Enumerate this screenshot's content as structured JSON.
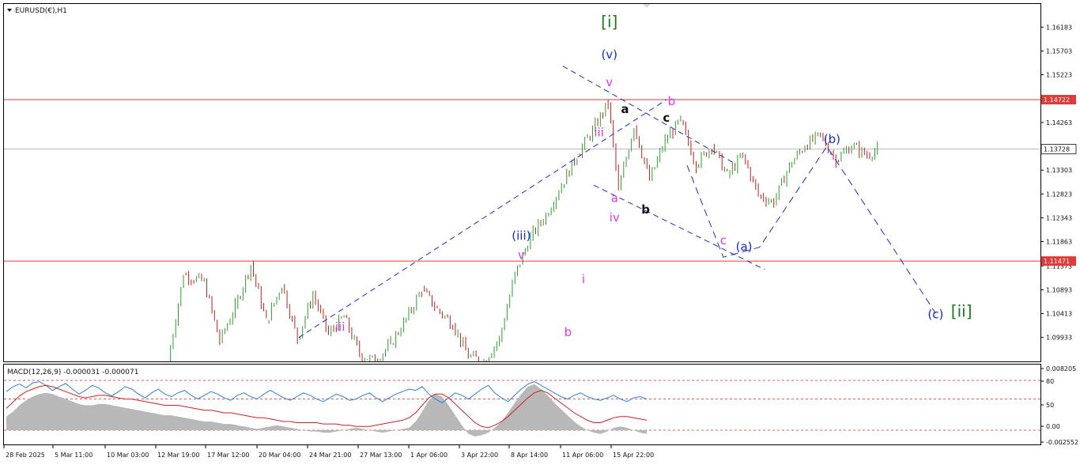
{
  "symbol_label": "EURUSD(€),H1",
  "indicator_label": "MACD(12,26,9) -0.000031 -0.000071",
  "colors": {
    "bull": "#2e9e2e",
    "bear": "#c02020",
    "level_line": "#e03a3a",
    "price_line": "#b8b8b8",
    "projection": "#1a2bc8",
    "wave_blue": "#1a2bc8",
    "wave_magenta": "#e23ae0",
    "wave_black": "#111111",
    "wave_green": "#1f7a1f",
    "macd_hist": "#b8b8b8",
    "macd_line": "#2f7fd6",
    "signal_line": "#d02020",
    "grid_dash": "#e02020"
  },
  "chart_data": [
    {
      "type": "candlestick",
      "symbol": "EURUSD(€)",
      "timeframe": "H1",
      "price_axis": {
        "range": [
          1.0945,
          1.1665
        ],
        "ticks": [
          "1.16183",
          "1.15703",
          "1.15223",
          "1.14263",
          "1.13303",
          "1.12823",
          "1.12343",
          "1.11863",
          "1.11373",
          "1.10893",
          "1.10413",
          "1.09933"
        ]
      },
      "time_axis": {
        "labels": [
          "28 Feb 2025",
          "5 Mar 11:00",
          "10 Mar 03:00",
          "12 Mar 19:00",
          "17 Mar 12:00",
          "20 Mar 04:00",
          "24 Mar 21:00",
          "27 Mar 13:00",
          "1 Apr 06:00",
          "3 Apr 22:00",
          "8 Apr 14:00",
          "11 Apr 06:00",
          "15 Apr 22:00"
        ]
      },
      "horizontal_levels": [
        {
          "price": 1.14722,
          "label": "1.14722"
        },
        {
          "price": 1.11471,
          "label": "1.11471"
        }
      ],
      "current_price": {
        "price": 1.13728,
        "label": "1.13728"
      },
      "price_path": [
        [
          0,
          1.0945
        ],
        [
          3,
          1.112
        ],
        [
          7,
          1.1105
        ],
        [
          10,
          1.0985
        ],
        [
          13,
          1.1055
        ],
        [
          16,
          1.114
        ],
        [
          19,
          1.1025
        ],
        [
          22,
          1.11
        ],
        [
          25,
          1.099
        ],
        [
          28,
          1.108
        ],
        [
          31,
          1.1
        ],
        [
          34,
          1.1035
        ],
        [
          37,
          1.096
        ],
        [
          40,
          1.0945
        ],
        [
          43,
          1.098
        ],
        [
          46,
          1.103
        ],
        [
          49,
          1.109
        ],
        [
          52,
          1.105
        ],
        [
          55,
          1.102
        ],
        [
          58,
          1.0955
        ],
        [
          61,
          1.0945
        ],
        [
          64,
          1.099
        ],
        [
          67,
          1.112
        ],
        [
          70,
          1.1195
        ],
        [
          73,
          1.124
        ],
        [
          76,
          1.13
        ],
        [
          79,
          1.136
        ],
        [
          82,
          1.141
        ],
        [
          85,
          1.1465
        ],
        [
          87,
          1.129
        ],
        [
          90,
          1.142
        ],
        [
          93,
          1.131
        ],
        [
          96,
          1.139
        ],
        [
          99,
          1.143
        ],
        [
          102,
          1.134
        ],
        [
          105,
          1.138
        ],
        [
          108,
          1.132
        ],
        [
          111,
          1.136
        ],
        [
          114,
          1.128
        ],
        [
          117,
          1.1265
        ],
        [
          120,
          1.134
        ],
        [
          123,
          1.138
        ],
        [
          126,
          1.14
        ],
        [
          129,
          1.135
        ],
        [
          132,
          1.138
        ],
        [
          135,
          1.136
        ],
        [
          137,
          1.1372
        ]
      ],
      "wave_labels": [
        {
          "text": "[i]",
          "color_key": "wave_green",
          "bar": 85,
          "price": 1.16183
        },
        {
          "text": "(v)",
          "color_key": "wave_blue",
          "bar": 85,
          "price": 1.1555
        },
        {
          "text": "v",
          "color_key": "wave_magenta",
          "bar": 85,
          "price": 1.1499
        },
        {
          "text": "iii",
          "color_key": "wave_magenta",
          "bar": 83,
          "price": 1.1398
        },
        {
          "text": "a",
          "color_key": "wave_black",
          "bar": 88,
          "price": 1.1445
        },
        {
          "text": "b",
          "color_key": "wave_magenta",
          "bar": 97,
          "price": 1.1461
        },
        {
          "text": "c",
          "color_key": "wave_black",
          "bar": 96,
          "price": 1.1428
        },
        {
          "text": "a",
          "color_key": "wave_magenta",
          "bar": 86,
          "price": 1.1266
        },
        {
          "text": "iv",
          "color_key": "wave_magenta",
          "bar": 86,
          "price": 1.1227
        },
        {
          "text": "b",
          "color_key": "wave_black",
          "bar": 92,
          "price": 1.1243
        },
        {
          "text": "c",
          "color_key": "wave_magenta",
          "bar": 107,
          "price": 1.1181
        },
        {
          "text": "(a)",
          "color_key": "wave_blue",
          "bar": 111,
          "price": 1.1168
        },
        {
          "text": "(b)",
          "color_key": "wave_blue",
          "bar": 128,
          "price": 1.1385
        },
        {
          "text": "(c)",
          "color_key": "wave_blue",
          "bar": 148,
          "price": 1.1032
        },
        {
          "text": "[ii]",
          "color_key": "wave_green",
          "bar": 153,
          "price": 1.1035
        },
        {
          "text": "(iii)",
          "color_key": "wave_blue",
          "bar": 68,
          "price": 1.119
        },
        {
          "text": "v",
          "color_key": "wave_magenta",
          "bar": 68,
          "price": 1.1151
        },
        {
          "text": "i",
          "color_key": "wave_magenta",
          "bar": 80,
          "price": 1.1103
        },
        {
          "text": "b",
          "color_key": "wave_magenta",
          "bar": 77,
          "price": 1.0996
        },
        {
          "text": "iii",
          "color_key": "wave_magenta",
          "bar": 33,
          "price": 1.1006
        }
      ],
      "trend_lines": [
        {
          "from": [
            25,
            1.0993
          ],
          "to": [
            96,
            1.1472
          ]
        },
        {
          "from": [
            76,
            1.154
          ],
          "to": [
            109,
            1.1345
          ]
        },
        {
          "from": [
            82,
            1.13
          ],
          "to": [
            115,
            1.113
          ]
        }
      ],
      "projection_path": [
        [
          100,
          1.134
        ],
        [
          107,
          1.1155
        ],
        [
          114,
          1.1175
        ],
        [
          127,
          1.1378
        ],
        [
          148,
          1.1042
        ]
      ]
    },
    {
      "type": "line",
      "indicator": "MACD(12,26,9)",
      "values": {
        "macd": -3.1e-05,
        "signal": -7.1e-05
      },
      "y_axis": {
        "ticks": [
          "0.008205",
          "80",
          "50",
          "0.00",
          "-0.002552"
        ]
      },
      "reference_levels": [
        80,
        50,
        0
      ],
      "series": [
        {
          "name": "MACD",
          "values": [
            62,
            70,
            74,
            68,
            76,
            78,
            72,
            64,
            70,
            75,
            66,
            58,
            64,
            72,
            68,
            60,
            55,
            62,
            70,
            66,
            58,
            52,
            60,
            66,
            58,
            54,
            60,
            64,
            56,
            50,
            56,
            62,
            58,
            52,
            48,
            56,
            60,
            54,
            50,
            58,
            64,
            58,
            52,
            48,
            54,
            60,
            56,
            50,
            46,
            52,
            58,
            54,
            48,
            50,
            56,
            60,
            52,
            46,
            52,
            58,
            62,
            66,
            64,
            70,
            58,
            50,
            44,
            52,
            60,
            56,
            50,
            58,
            66,
            72,
            60,
            52,
            46,
            56,
            66,
            74,
            78,
            72,
            66,
            60,
            54,
            50,
            56,
            60,
            54,
            50,
            48,
            52,
            56,
            50,
            46,
            52,
            54,
            50
          ]
        },
        {
          "name": "Signal",
          "values": [
            35,
            45,
            55,
            62,
            66,
            70,
            72,
            70,
            66,
            62,
            58,
            54,
            52,
            54,
            56,
            56,
            54,
            52,
            50,
            50,
            48,
            46,
            44,
            42,
            40,
            40,
            40,
            38,
            36,
            34,
            32,
            32,
            30,
            28,
            28,
            26,
            24,
            22,
            20,
            20,
            18,
            16,
            14,
            14,
            12,
            12,
            12,
            12,
            10,
            10,
            10,
            8,
            8,
            6,
            6,
            6,
            8,
            10,
            12,
            14,
            16,
            20,
            28,
            40,
            52,
            58,
            58,
            52,
            42,
            32,
            22,
            12,
            6,
            4,
            8,
            14,
            22,
            32,
            42,
            52,
            60,
            64,
            60,
            52,
            44,
            36,
            28,
            22,
            16,
            12,
            12,
            16,
            20,
            22,
            22,
            20,
            18,
            16
          ]
        }
      ],
      "histogram": [
        22,
        30,
        40,
        48,
        54,
        58,
        60,
        58,
        54,
        50,
        46,
        42,
        40,
        40,
        42,
        42,
        40,
        38,
        36,
        34,
        32,
        30,
        28,
        26,
        24,
        24,
        22,
        20,
        18,
        16,
        14,
        14,
        12,
        10,
        10,
        8,
        6,
        4,
        2,
        4,
        6,
        8,
        6,
        4,
        2,
        0,
        -2,
        -2,
        -4,
        -4,
        -2,
        0,
        2,
        4,
        2,
        0,
        -2,
        -4,
        -2,
        0,
        2,
        4,
        14,
        30,
        48,
        58,
        54,
        40,
        24,
        8,
        -6,
        -10,
        -8,
        -4,
        4,
        14,
        28,
        44,
        58,
        70,
        74,
        66,
        56,
        44,
        34,
        24,
        14,
        6,
        0,
        -4,
        -6,
        -2,
        4,
        6,
        4,
        0,
        -4,
        -6
      ]
    }
  ]
}
